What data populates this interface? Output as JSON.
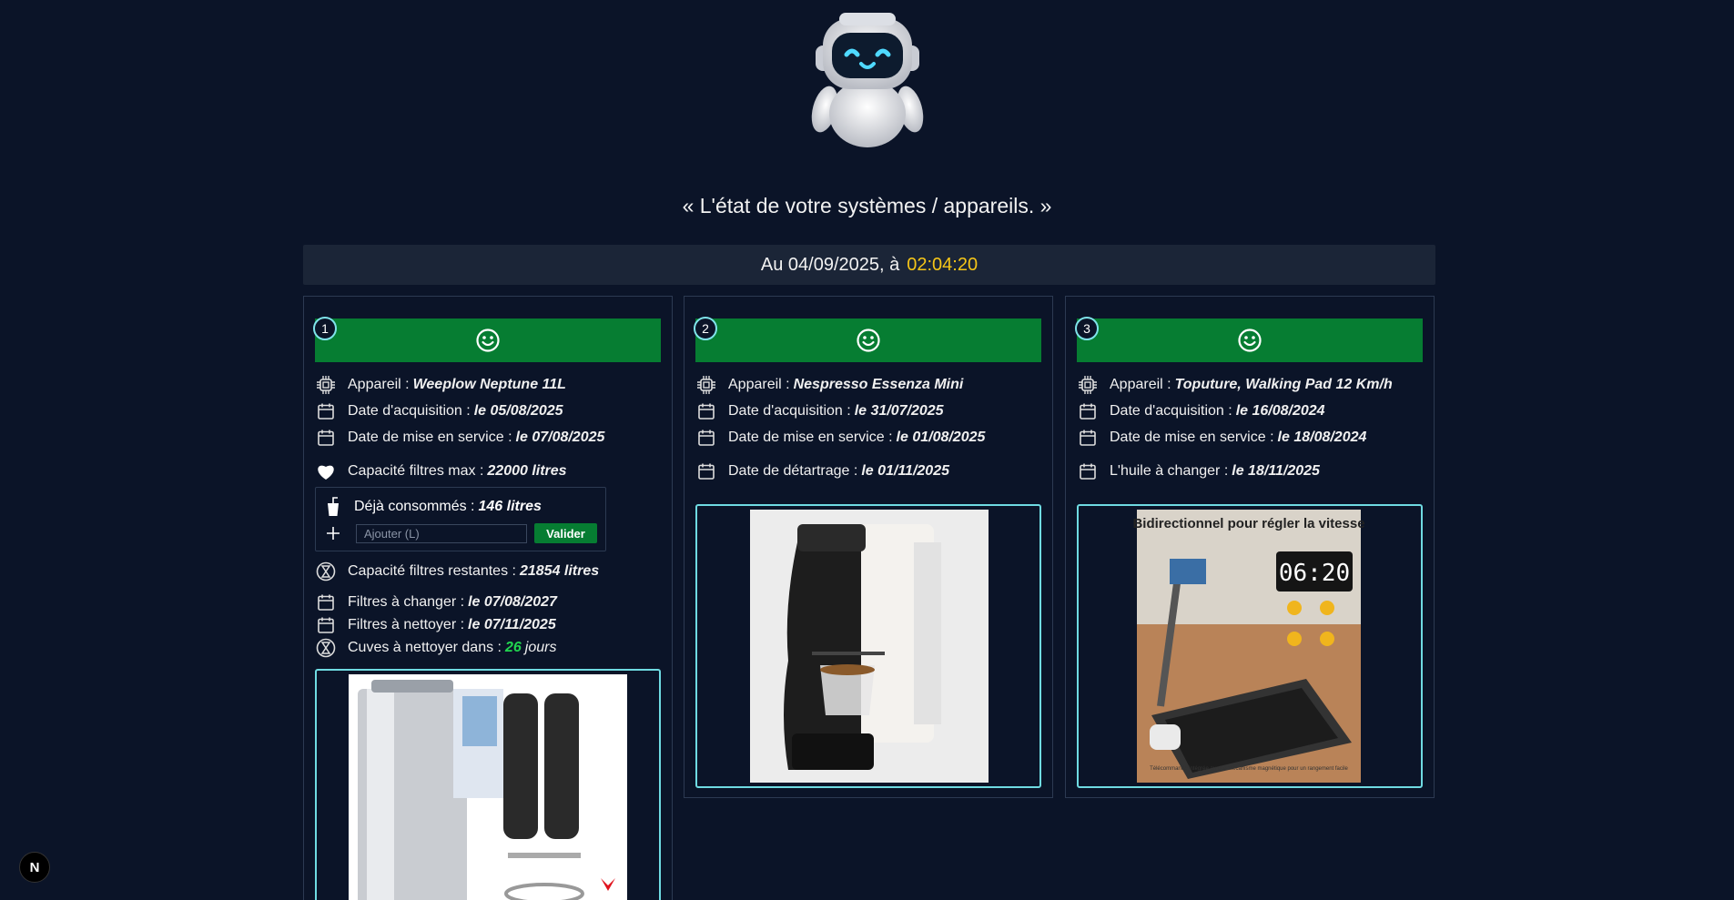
{
  "headline": "« L'état de votre systèmes / appareils. »",
  "datebar": {
    "date": "Au 04/09/2025, à",
    "time": "02:04:20"
  },
  "colors": {
    "status_ok": "#067d32",
    "accent_time": "#f5c518",
    "photo_border": "#6fdbe2",
    "good_value": "#21d44f"
  },
  "cards": [
    {
      "number": "1",
      "status_icon": "smiley-icon",
      "device_label": "Appareil :",
      "device": "Weeplow Neptune 11L",
      "acq_label": "Date d'acquisition :",
      "acq": "le 05/08/2025",
      "service_label": "Date de mise en service :",
      "service": "le 07/08/2025",
      "capacity_label": "Capacité filtres max :",
      "capacity": "22000 litres",
      "consumed_label": "Déjà consommés :",
      "consumed": "146 litres",
      "add_placeholder": "Ajouter (L)",
      "validate": "Valider",
      "remaining_label": "Capacité filtres restantes :",
      "remaining": "21854 litres",
      "change_label": "Filtres à changer :",
      "change": "le 07/08/2027",
      "clean_label": "Filtres à nettoyer :",
      "clean": "le 07/11/2025",
      "tanks_label": "Cuves à nettoyer dans :",
      "tanks_days": "26",
      "tanks_unit": "jours",
      "photo": "water-filter-photo"
    },
    {
      "number": "2",
      "status_icon": "smiley-icon",
      "device_label": "Appareil :",
      "device": "Nespresso Essenza Mini",
      "acq_label": "Date d'acquisition :",
      "acq": "le 31/07/2025",
      "service_label": "Date de mise en service :",
      "service": "le 01/08/2025",
      "descale_label": "Date de détartrage :",
      "descale": "le 01/11/2025",
      "photo": "coffee-machine-photo"
    },
    {
      "number": "3",
      "status_icon": "smiley-icon",
      "device_label": "Appareil :",
      "device": "Toputure, Walking Pad 12 Km/h",
      "acq_label": "Date d'acquisition :",
      "acq": "le 16/08/2024",
      "service_label": "Date de mise en service :",
      "service": "le 18/08/2024",
      "oil_label": "L'huile à changer :",
      "oil": "le 18/11/2025",
      "photo": "walking-pad-photo",
      "photo_title": "Bidirectionnel pour régler la vitesse",
      "photo_clock": "06:20",
      "photo_caption": "Télécommande intégrée au dos Mécanisme magnétique pour un rangement facile"
    }
  ],
  "nextjs_badge": "N"
}
